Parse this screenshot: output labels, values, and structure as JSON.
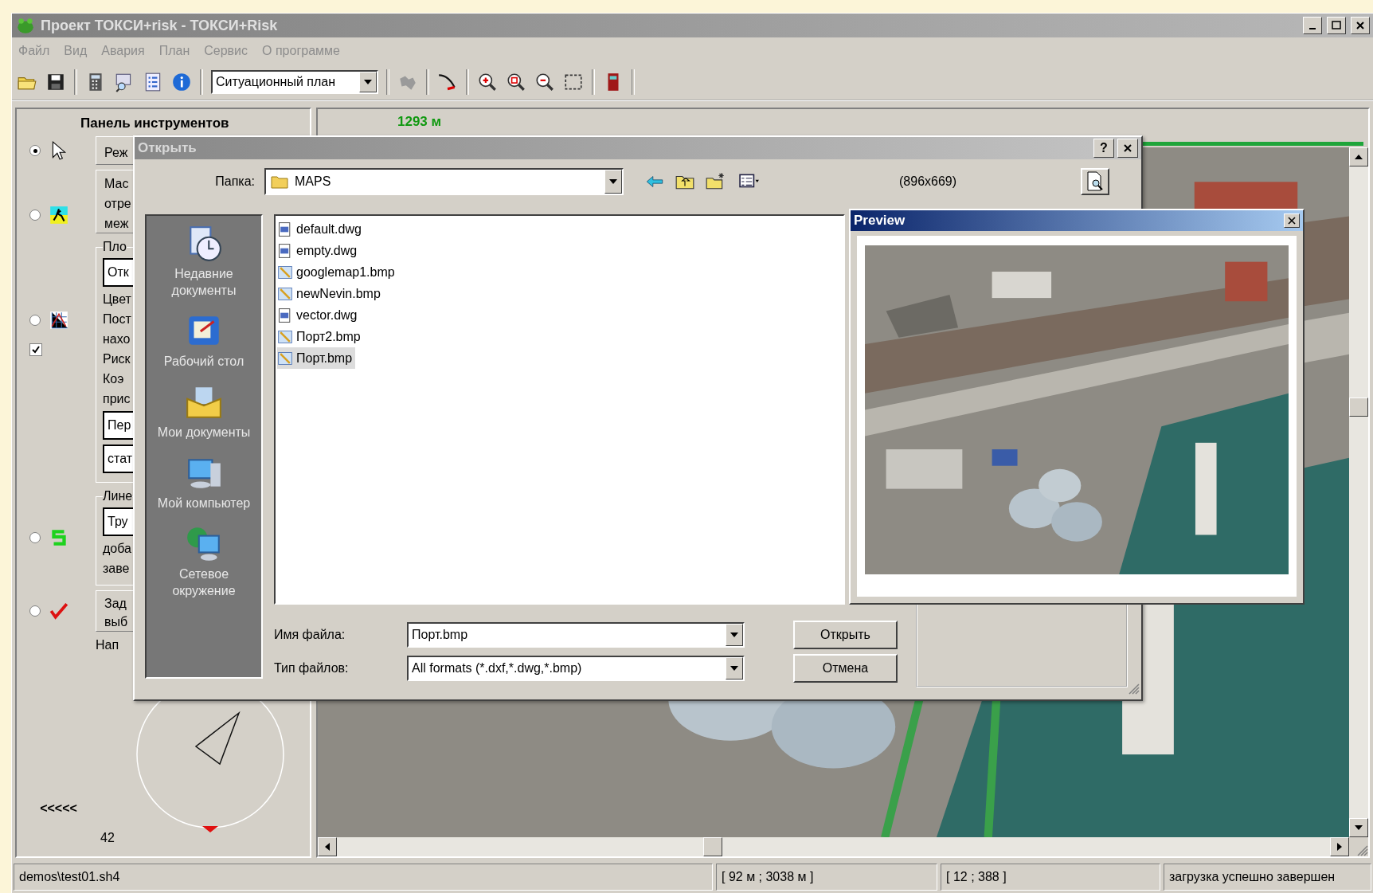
{
  "window": {
    "title": "Проект ТОКСИ+risk - ТОКСИ+Risk"
  },
  "menu": [
    "Файл",
    "Вид",
    "Авария",
    "План",
    "Сервис",
    "О программе"
  ],
  "toolbar": {
    "view_select": "Ситуационный план"
  },
  "tool_panel": {
    "title": "Панель инструментов",
    "modes": [
      {
        "selected": true
      },
      {
        "selected": false
      },
      {
        "selected": false
      },
      {
        "selected": false
      },
      {
        "selected": false
      }
    ],
    "show_risk": {
      "checked": true
    },
    "mode_button": "Реж",
    "scale_lines": [
      "Мас",
      "отре",
      "меж"
    ],
    "area_group": {
      "legend": "Пло",
      "field": "Отк",
      "lines": [
        "Цвет",
        "Пост",
        "нахо",
        "Риск",
        "Коэ",
        "прис"
      ],
      "fields": [
        "Пер",
        "стат"
      ]
    },
    "line_group": {
      "legend": "Лине",
      "field": "Тру",
      "lines": [
        "доба",
        "заве"
      ]
    },
    "task_lines": [
      "Зад",
      "выб"
    ],
    "direction_label": "Нап",
    "wind_arrows": "<<<<<",
    "wind_value": "42"
  },
  "map": {
    "ruler_label": "1293 м"
  },
  "dialog": {
    "title": "Открыть",
    "help_button": "?",
    "folder_label": "Папка:",
    "folder": "MAPS",
    "image_size": "(896x669)",
    "places": [
      {
        "label": "Недавние документы"
      },
      {
        "label": "Рабочий стол"
      },
      {
        "label": "Мои документы"
      },
      {
        "label": "Мой компьютер"
      },
      {
        "label": "Сетевое окружение"
      }
    ],
    "files": [
      {
        "name": "default.dwg",
        "kind": "drawing",
        "selected": false
      },
      {
        "name": "empty.dwg",
        "kind": "drawing",
        "selected": false
      },
      {
        "name": "googlemap1.bmp",
        "selected": false
      },
      {
        "name": "newNevin.bmp",
        "selected": false
      },
      {
        "name": "vector.dwg",
        "kind": "drawing",
        "selected": false
      },
      {
        "name": "Порт2.bmp",
        "selected": false
      },
      {
        "name": "Порт.bmp",
        "selected": true
      }
    ],
    "filename_label": "Имя файла:",
    "filename": "Порт.bmp",
    "filetype_label": "Тип файлов:",
    "filetype": "All formats (*.dxf,*.dwg,*.bmp)",
    "buttons": [
      "Открыть",
      "Отмена"
    ]
  },
  "preview": {
    "title": "Preview"
  },
  "status_bar": [
    "demos\\test01.sh4",
    "[ 92 м ; 3038 м ]",
    "[ 12 ; 388 ]",
    "загрузка успешно завершен"
  ]
}
